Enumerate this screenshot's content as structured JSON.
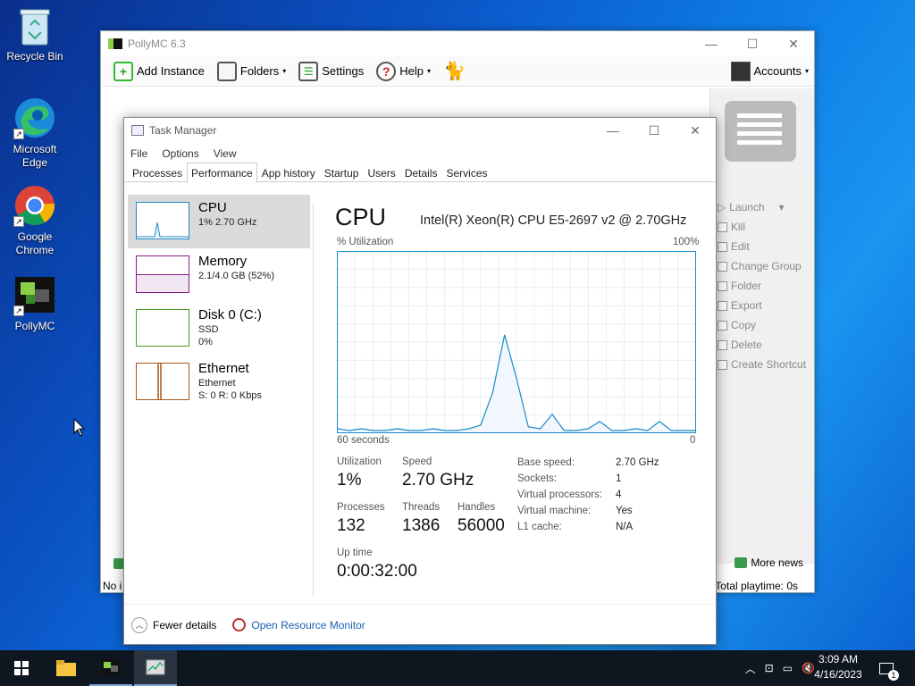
{
  "desktop": {
    "icons": [
      {
        "label": "Recycle Bin"
      },
      {
        "label": "Microsoft Edge"
      },
      {
        "label": "Google Chrome"
      },
      {
        "label": "PollyMC"
      }
    ]
  },
  "polly": {
    "title": "PollyMC 6.3",
    "toolbar": {
      "add_instance": "Add Instance",
      "folders": "Folders",
      "settings": "Settings",
      "help": "Help",
      "accounts": "Accounts"
    },
    "actions": [
      "Launch",
      "Kill",
      "Edit",
      "Change Group",
      "Folder",
      "Export",
      "Copy",
      "Delete",
      "Create Shortcut"
    ],
    "more_news": "More news",
    "status_left": "No i",
    "total_playtime": "Total playtime: 0s"
  },
  "taskmanager": {
    "title": "Task Manager",
    "menu": [
      "File",
      "Options",
      "View"
    ],
    "tabs": [
      "Processes",
      "Performance",
      "App history",
      "Startup",
      "Users",
      "Details",
      "Services"
    ],
    "resources": [
      {
        "name": "CPU",
        "sub1": "1%  2.70 GHz",
        "sub2": "",
        "sub3": ""
      },
      {
        "name": "Memory",
        "sub1": "2.1/4.0 GB (52%)",
        "sub2": "",
        "sub3": ""
      },
      {
        "name": "Disk 0 (C:)",
        "sub1": "SSD",
        "sub2": "0%",
        "sub3": ""
      },
      {
        "name": "Ethernet",
        "sub1": "Ethernet",
        "sub2": "S: 0  R: 0 Kbps",
        "sub3": ""
      }
    ],
    "cpu": {
      "heading": "CPU",
      "model": "Intel(R) Xeon(R) CPU E5-2697 v2 @ 2.70GHz",
      "util_label": "% Utilization",
      "max_label": "100%",
      "time_label": "60 seconds",
      "min_label": "0",
      "utilization_label": "Utilization",
      "utilization": "1%",
      "speed_label": "Speed",
      "speed": "2.70 GHz",
      "processes_label": "Processes",
      "processes": "132",
      "threads_label": "Threads",
      "threads": "1386",
      "handles_label": "Handles",
      "handles": "56000",
      "uptime_label": "Up time",
      "uptime": "0:00:32:00",
      "details": [
        {
          "k": "Base speed:",
          "v": "2.70 GHz"
        },
        {
          "k": "Sockets:",
          "v": "1"
        },
        {
          "k": "Virtual processors:",
          "v": "4"
        },
        {
          "k": "Virtual machine:",
          "v": "Yes"
        },
        {
          "k": "L1 cache:",
          "v": "N/A"
        }
      ]
    },
    "fewer_details": "Fewer details",
    "open_monitor": "Open Resource Monitor"
  },
  "chart_data": {
    "type": "line",
    "title": "CPU",
    "xlabel": "60 seconds",
    "ylabel": "% Utilization",
    "ylim": [
      0,
      100
    ],
    "x": [
      0,
      2,
      4,
      6,
      8,
      10,
      12,
      14,
      16,
      18,
      20,
      22,
      24,
      26,
      28,
      30,
      32,
      34,
      36,
      38,
      40,
      42,
      44,
      46,
      48,
      50,
      52,
      54,
      56,
      58,
      60
    ],
    "series": [
      {
        "values": [
          2,
          1,
          2,
          1,
          1,
          2,
          1,
          1,
          2,
          1,
          1,
          2,
          4,
          22,
          54,
          30,
          3,
          2,
          10,
          1,
          1,
          2,
          6,
          1,
          1,
          2,
          1,
          6,
          1,
          1,
          1
        ]
      }
    ]
  },
  "taskbar": {
    "time": "3:09 AM",
    "date": "4/16/2023",
    "notif": "1"
  }
}
